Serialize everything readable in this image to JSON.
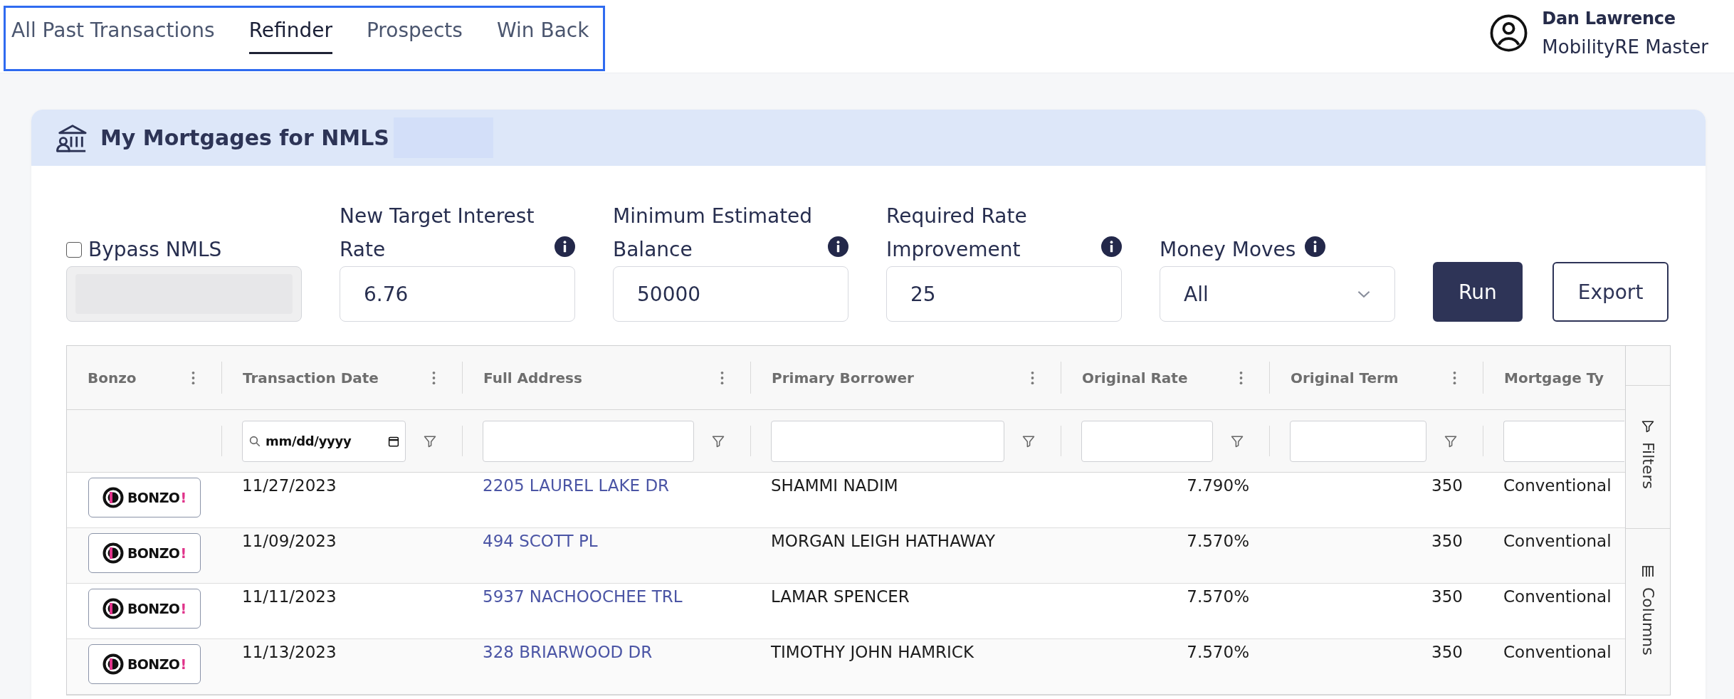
{
  "tab_bar": {
    "highlighted": true,
    "tabs": [
      {
        "label": "All Past Transactions",
        "selected": false
      },
      {
        "label": "Refinder",
        "selected": true
      },
      {
        "label": "Prospects",
        "selected": false
      },
      {
        "label": "Win Back",
        "selected": false
      }
    ]
  },
  "user": {
    "name": "Dan Lawrence",
    "role": "MobilityRE Master"
  },
  "card": {
    "title": "My Mortgages for NMLS",
    "title_redacted": true
  },
  "filters": {
    "bypass": {
      "label": "Bypass NMLS",
      "checked": false
    },
    "nmls_field": {
      "disabled": true,
      "value_redacted": true
    },
    "fields": [
      {
        "kind": "input",
        "label": "New Target Interest Rate",
        "info": true,
        "value": "6.76"
      },
      {
        "kind": "input",
        "label": "Minimum Estimated Balance",
        "info": true,
        "value": "50000"
      },
      {
        "kind": "input",
        "label": "Required Rate Improvement",
        "info": true,
        "value": "25"
      },
      {
        "kind": "select",
        "label": "Money Moves",
        "info": true,
        "value": "All"
      }
    ],
    "buttons": [
      {
        "kind": "primary",
        "label": "Run"
      },
      {
        "kind": "outline",
        "label": "Export"
      }
    ]
  },
  "table": {
    "columns": [
      {
        "label": "Bonzo",
        "kind": "button"
      },
      {
        "label": "Transaction Date",
        "kind": "text",
        "filter": {
          "kind": "date",
          "placeholder": "mm/dd/yyyy"
        }
      },
      {
        "label": "Full Address",
        "kind": "link",
        "filter": {
          "kind": "text"
        }
      },
      {
        "label": "Primary Borrower",
        "kind": "text",
        "filter": {
          "kind": "text"
        }
      },
      {
        "label": "Original Rate",
        "kind": "number",
        "filter": {
          "kind": "text"
        }
      },
      {
        "label": "Original Term",
        "kind": "number",
        "filter": {
          "kind": "text"
        }
      },
      {
        "label": "Mortgage Ty",
        "kind": "text",
        "filter": {
          "kind": "text"
        }
      }
    ],
    "rows": [
      {
        "cells": [
          {
            "label": "BONZO",
            "accent": "!"
          },
          "11/27/2023",
          "2205 LAUREL LAKE DR",
          "SHAMMI NADIM",
          "7.790%",
          "350",
          "Conventional"
        ]
      },
      {
        "cells": [
          {
            "label": "BONZO",
            "accent": "!"
          },
          "11/09/2023",
          "494 SCOTT PL",
          "MORGAN LEIGH HATHAWAY",
          "7.570%",
          "350",
          "Conventional"
        ]
      },
      {
        "cells": [
          {
            "label": "BONZO",
            "accent": "!"
          },
          "11/11/2023",
          "5937 NACHOOCHEE TRL",
          "LAMAR SPENCER",
          "7.570%",
          "350",
          "Conventional"
        ]
      },
      {
        "cells": [
          {
            "label": "BONZO",
            "accent": "!"
          },
          "11/13/2023",
          "328 BRIARWOOD DR",
          "TIMOTHY JOHN HAMRICK",
          "7.570%",
          "350",
          "Conventional"
        ]
      }
    ],
    "side_tabs": [
      {
        "kind": "filters",
        "label": "Filters"
      },
      {
        "kind": "columns",
        "label": "Columns"
      }
    ]
  }
}
